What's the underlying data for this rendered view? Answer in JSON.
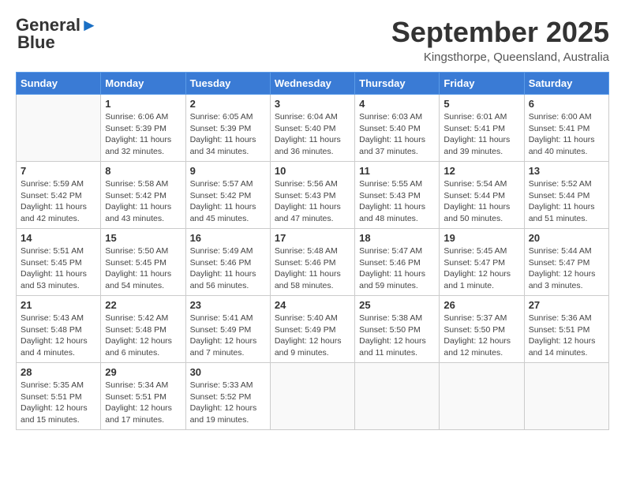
{
  "header": {
    "logo_line1": "General",
    "logo_line2": "Blue",
    "month": "September 2025",
    "location": "Kingsthorpe, Queensland, Australia"
  },
  "weekdays": [
    "Sunday",
    "Monday",
    "Tuesday",
    "Wednesday",
    "Thursday",
    "Friday",
    "Saturday"
  ],
  "weeks": [
    [
      {
        "day": "",
        "info": ""
      },
      {
        "day": "1",
        "info": "Sunrise: 6:06 AM\nSunset: 5:39 PM\nDaylight: 11 hours\nand 32 minutes."
      },
      {
        "day": "2",
        "info": "Sunrise: 6:05 AM\nSunset: 5:39 PM\nDaylight: 11 hours\nand 34 minutes."
      },
      {
        "day": "3",
        "info": "Sunrise: 6:04 AM\nSunset: 5:40 PM\nDaylight: 11 hours\nand 36 minutes."
      },
      {
        "day": "4",
        "info": "Sunrise: 6:03 AM\nSunset: 5:40 PM\nDaylight: 11 hours\nand 37 minutes."
      },
      {
        "day": "5",
        "info": "Sunrise: 6:01 AM\nSunset: 5:41 PM\nDaylight: 11 hours\nand 39 minutes."
      },
      {
        "day": "6",
        "info": "Sunrise: 6:00 AM\nSunset: 5:41 PM\nDaylight: 11 hours\nand 40 minutes."
      }
    ],
    [
      {
        "day": "7",
        "info": "Sunrise: 5:59 AM\nSunset: 5:42 PM\nDaylight: 11 hours\nand 42 minutes."
      },
      {
        "day": "8",
        "info": "Sunrise: 5:58 AM\nSunset: 5:42 PM\nDaylight: 11 hours\nand 43 minutes."
      },
      {
        "day": "9",
        "info": "Sunrise: 5:57 AM\nSunset: 5:42 PM\nDaylight: 11 hours\nand 45 minutes."
      },
      {
        "day": "10",
        "info": "Sunrise: 5:56 AM\nSunset: 5:43 PM\nDaylight: 11 hours\nand 47 minutes."
      },
      {
        "day": "11",
        "info": "Sunrise: 5:55 AM\nSunset: 5:43 PM\nDaylight: 11 hours\nand 48 minutes."
      },
      {
        "day": "12",
        "info": "Sunrise: 5:54 AM\nSunset: 5:44 PM\nDaylight: 11 hours\nand 50 minutes."
      },
      {
        "day": "13",
        "info": "Sunrise: 5:52 AM\nSunset: 5:44 PM\nDaylight: 11 hours\nand 51 minutes."
      }
    ],
    [
      {
        "day": "14",
        "info": "Sunrise: 5:51 AM\nSunset: 5:45 PM\nDaylight: 11 hours\nand 53 minutes."
      },
      {
        "day": "15",
        "info": "Sunrise: 5:50 AM\nSunset: 5:45 PM\nDaylight: 11 hours\nand 54 minutes."
      },
      {
        "day": "16",
        "info": "Sunrise: 5:49 AM\nSunset: 5:46 PM\nDaylight: 11 hours\nand 56 minutes."
      },
      {
        "day": "17",
        "info": "Sunrise: 5:48 AM\nSunset: 5:46 PM\nDaylight: 11 hours\nand 58 minutes."
      },
      {
        "day": "18",
        "info": "Sunrise: 5:47 AM\nSunset: 5:46 PM\nDaylight: 11 hours\nand 59 minutes."
      },
      {
        "day": "19",
        "info": "Sunrise: 5:45 AM\nSunset: 5:47 PM\nDaylight: 12 hours\nand 1 minute."
      },
      {
        "day": "20",
        "info": "Sunrise: 5:44 AM\nSunset: 5:47 PM\nDaylight: 12 hours\nand 3 minutes."
      }
    ],
    [
      {
        "day": "21",
        "info": "Sunrise: 5:43 AM\nSunset: 5:48 PM\nDaylight: 12 hours\nand 4 minutes."
      },
      {
        "day": "22",
        "info": "Sunrise: 5:42 AM\nSunset: 5:48 PM\nDaylight: 12 hours\nand 6 minutes."
      },
      {
        "day": "23",
        "info": "Sunrise: 5:41 AM\nSunset: 5:49 PM\nDaylight: 12 hours\nand 7 minutes."
      },
      {
        "day": "24",
        "info": "Sunrise: 5:40 AM\nSunset: 5:49 PM\nDaylight: 12 hours\nand 9 minutes."
      },
      {
        "day": "25",
        "info": "Sunrise: 5:38 AM\nSunset: 5:50 PM\nDaylight: 12 hours\nand 11 minutes."
      },
      {
        "day": "26",
        "info": "Sunrise: 5:37 AM\nSunset: 5:50 PM\nDaylight: 12 hours\nand 12 minutes."
      },
      {
        "day": "27",
        "info": "Sunrise: 5:36 AM\nSunset: 5:51 PM\nDaylight: 12 hours\nand 14 minutes."
      }
    ],
    [
      {
        "day": "28",
        "info": "Sunrise: 5:35 AM\nSunset: 5:51 PM\nDaylight: 12 hours\nand 15 minutes."
      },
      {
        "day": "29",
        "info": "Sunrise: 5:34 AM\nSunset: 5:51 PM\nDaylight: 12 hours\nand 17 minutes."
      },
      {
        "day": "30",
        "info": "Sunrise: 5:33 AM\nSunset: 5:52 PM\nDaylight: 12 hours\nand 19 minutes."
      },
      {
        "day": "",
        "info": ""
      },
      {
        "day": "",
        "info": ""
      },
      {
        "day": "",
        "info": ""
      },
      {
        "day": "",
        "info": ""
      }
    ]
  ]
}
